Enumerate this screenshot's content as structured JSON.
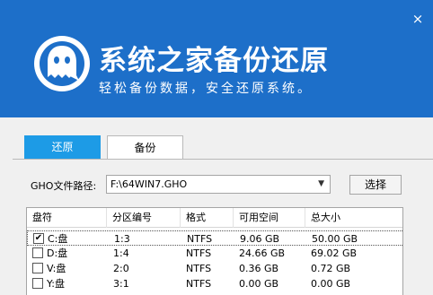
{
  "header": {
    "title": "系统之家备份还原",
    "subtitle": "轻松备份数据，安全还原系统。",
    "close_label": "×",
    "brand_color": "#1d6fc9"
  },
  "tabs": [
    {
      "label": "还原",
      "active": true
    },
    {
      "label": "备份",
      "active": false
    }
  ],
  "path": {
    "label": "GHO文件路径:",
    "value": "F:\\64WIN7.GHO",
    "select_button": "选择"
  },
  "table": {
    "columns": [
      "盘符",
      "分区编号",
      "格式",
      "可用空间",
      "总大小"
    ],
    "rows": [
      {
        "checked": true,
        "drive": "C:盘",
        "partition": "1:3",
        "format": "NTFS",
        "free": "9.06 GB",
        "total": "50.00 GB"
      },
      {
        "checked": false,
        "drive": "D:盘",
        "partition": "1:4",
        "format": "NTFS",
        "free": "24.66 GB",
        "total": "69.02 GB"
      },
      {
        "checked": false,
        "drive": "V:盘",
        "partition": "2:0",
        "format": "NTFS",
        "free": "0.36 GB",
        "total": "0.72 GB"
      },
      {
        "checked": false,
        "drive": "Y:盘",
        "partition": "3:1",
        "format": "NTFS",
        "free": "0.00 GB",
        "total": "0.00 GB"
      }
    ]
  }
}
